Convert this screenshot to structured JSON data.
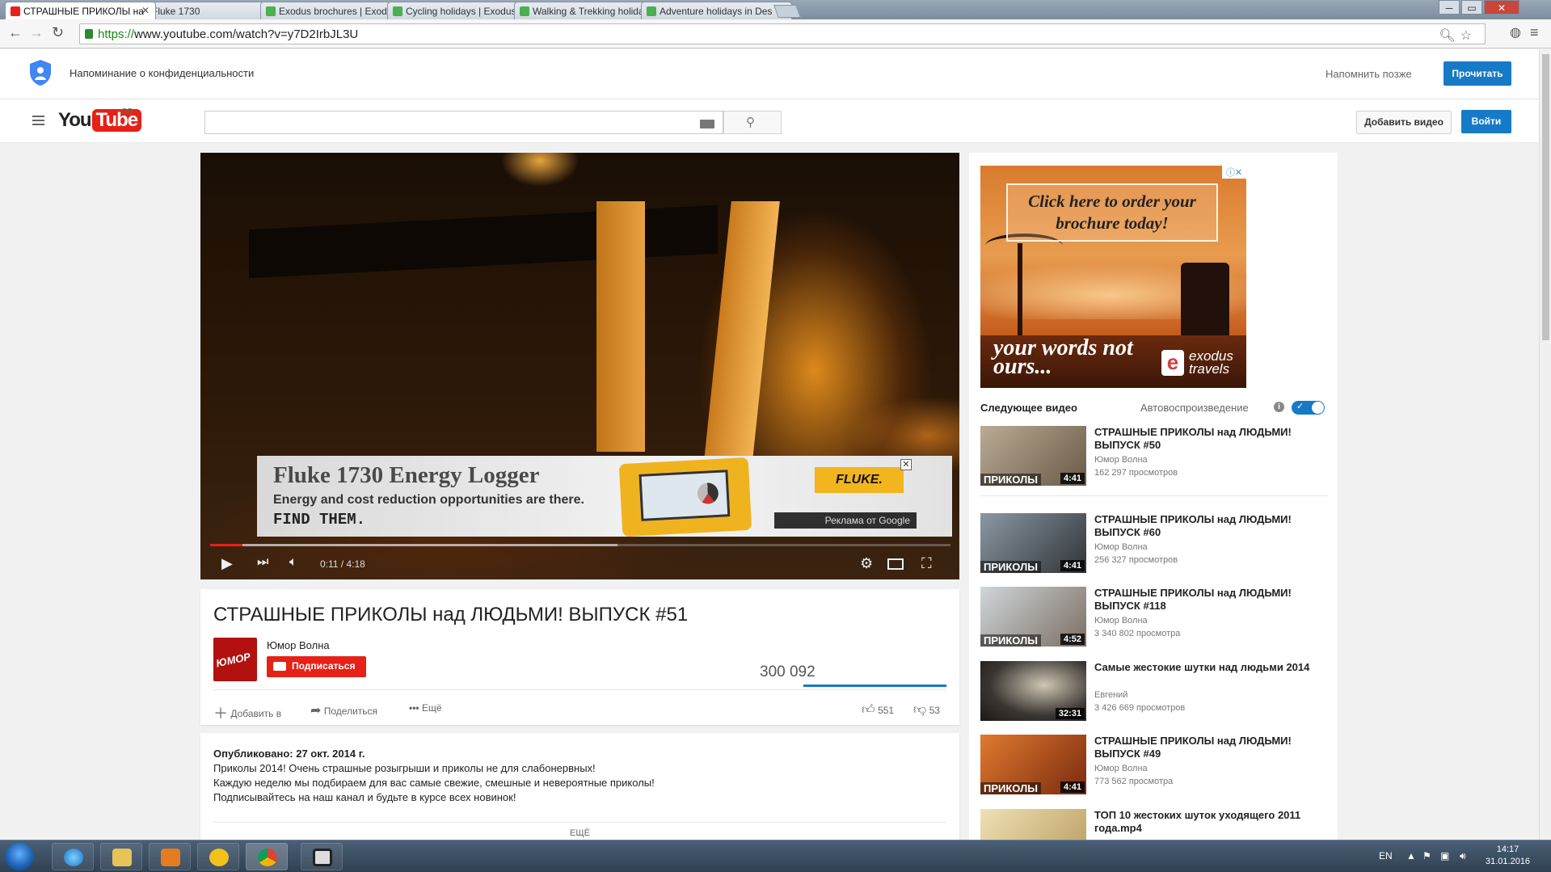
{
  "browser": {
    "tabs": [
      {
        "title": "СТРАШНЫЕ ПРИКОЛЫ на",
        "active": true,
        "color": "#e62117"
      },
      {
        "title": "Fluke 1730",
        "active": false,
        "color": "#f2b51e"
      },
      {
        "title": "Exodus brochures | Exodus",
        "active": false,
        "color": "#4caf50"
      },
      {
        "title": "Cycling holidays | Exodus",
        "active": false,
        "color": "#4caf50"
      },
      {
        "title": "Walking & Trekking holiday",
        "active": false,
        "color": "#4caf50"
      },
      {
        "title": "Adventure holidays in Des",
        "active": false,
        "color": "#4caf50"
      }
    ],
    "tab_close": "✕",
    "url_scheme": "https://",
    "url_rest": "www.youtube.com/watch?v=y7D2IrbJL3U",
    "window_controls": [
      "─",
      "▭",
      "✕"
    ]
  },
  "privacy": {
    "text": "Напоминание о конфиденциальности",
    "remind_later": "Напомнить позже",
    "read": "Прочитать"
  },
  "masthead": {
    "logo_you": "You",
    "logo_tube": "Tube",
    "region": "GB",
    "search_placeholder": "",
    "upload": "Добавить видео",
    "signin": "Войти"
  },
  "player": {
    "ad": {
      "title": "Fluke 1730 Energy Logger",
      "line1": "Energy and cost reduction opportunities are there.",
      "line2": "FIND THEM.",
      "brand": "FLUKE.",
      "by": "Реклама от Google",
      "close": "✕"
    },
    "progress_fraction": 0.044,
    "buffered_fraction": 0.55,
    "time": "0:11 / 4:18"
  },
  "video": {
    "title": "СТРАШНЫЕ ПРИКОЛЫ над ЛЮДЬМИ! ВЫПУСК #51",
    "channel": "Юмор Волна",
    "avatar_text": "ЮМОР",
    "subscribe": "Подписаться",
    "views": "300 092",
    "add_to": "Добавить в",
    "share": "Поделиться",
    "more": "Ещё",
    "likes": "551",
    "dislikes": "53"
  },
  "description": {
    "published": "Опубликовано: 27 окт. 2014 г.",
    "lines": [
      "Приколы 2014! Очень страшные розыгрыши и приколы не для слабонервных!",
      "Каждую неделю мы подбираем для вас самые свежие, смешные и невероятные приколы!",
      "Подписывайтесь на наш канал и будьте в курсе всех новинок!"
    ],
    "show_more": "ЕЩЁ"
  },
  "sidebar": {
    "ad": {
      "cta": "Click here to order your brochure today!",
      "tagline": "your words not ours...",
      "brand": "exodus travels"
    },
    "next_label": "Следующее видео",
    "autoplay_label": "Автовоспроизведение",
    "items": [
      {
        "title": "СТРАШНЫЕ ПРИКОЛЫ над ЛЮДЬМИ! ВЫПУСК #50",
        "channel": "Юмор Волна",
        "views": "162 297 просмотров",
        "duration": "4:41",
        "caption": "ПРИКОЛЫ",
        "color": "#8a7a66"
      },
      {
        "title": "СТРАШНЫЕ ПРИКОЛЫ над ЛЮДЬМИ! ВЫПУСК #60",
        "channel": "Юмор Волна",
        "views": "256 327 просмотров",
        "duration": "4:41",
        "caption": "ПРИКОЛЫ",
        "color": "#5c6670"
      },
      {
        "title": "СТРАШНЫЕ ПРИКОЛЫ над ЛЮДЬМИ! ВЫПУСК #118",
        "channel": "Юмор Волна",
        "views": "3 340 802 просмотра",
        "duration": "4:52",
        "caption": "ПРИКОЛЫ",
        "color": "#9aa3a8"
      },
      {
        "title": "Самые жестокие шутки над людьми 2014",
        "channel": "Евгений",
        "views": "3 426 669 просмотров",
        "duration": "32:31",
        "caption": "",
        "color": "#3a3632"
      },
      {
        "title": "СТРАШНЫЕ ПРИКОЛЫ над ЛЮДЬМИ! ВЫПУСК #49",
        "channel": "Юмор Волна",
        "views": "773 562 просмотра",
        "duration": "4:41",
        "caption": "ПРИКОЛЫ",
        "color": "#b8561e"
      },
      {
        "title": "ТОП 10 жестоких шуток уходящего 2011 года.mp4",
        "channel": "",
        "views": "",
        "duration": "",
        "caption": "",
        "color": "#d8c08a"
      }
    ]
  },
  "taskbar": {
    "lang": "EN",
    "time": "14:17",
    "date": "31.01.2016"
  }
}
